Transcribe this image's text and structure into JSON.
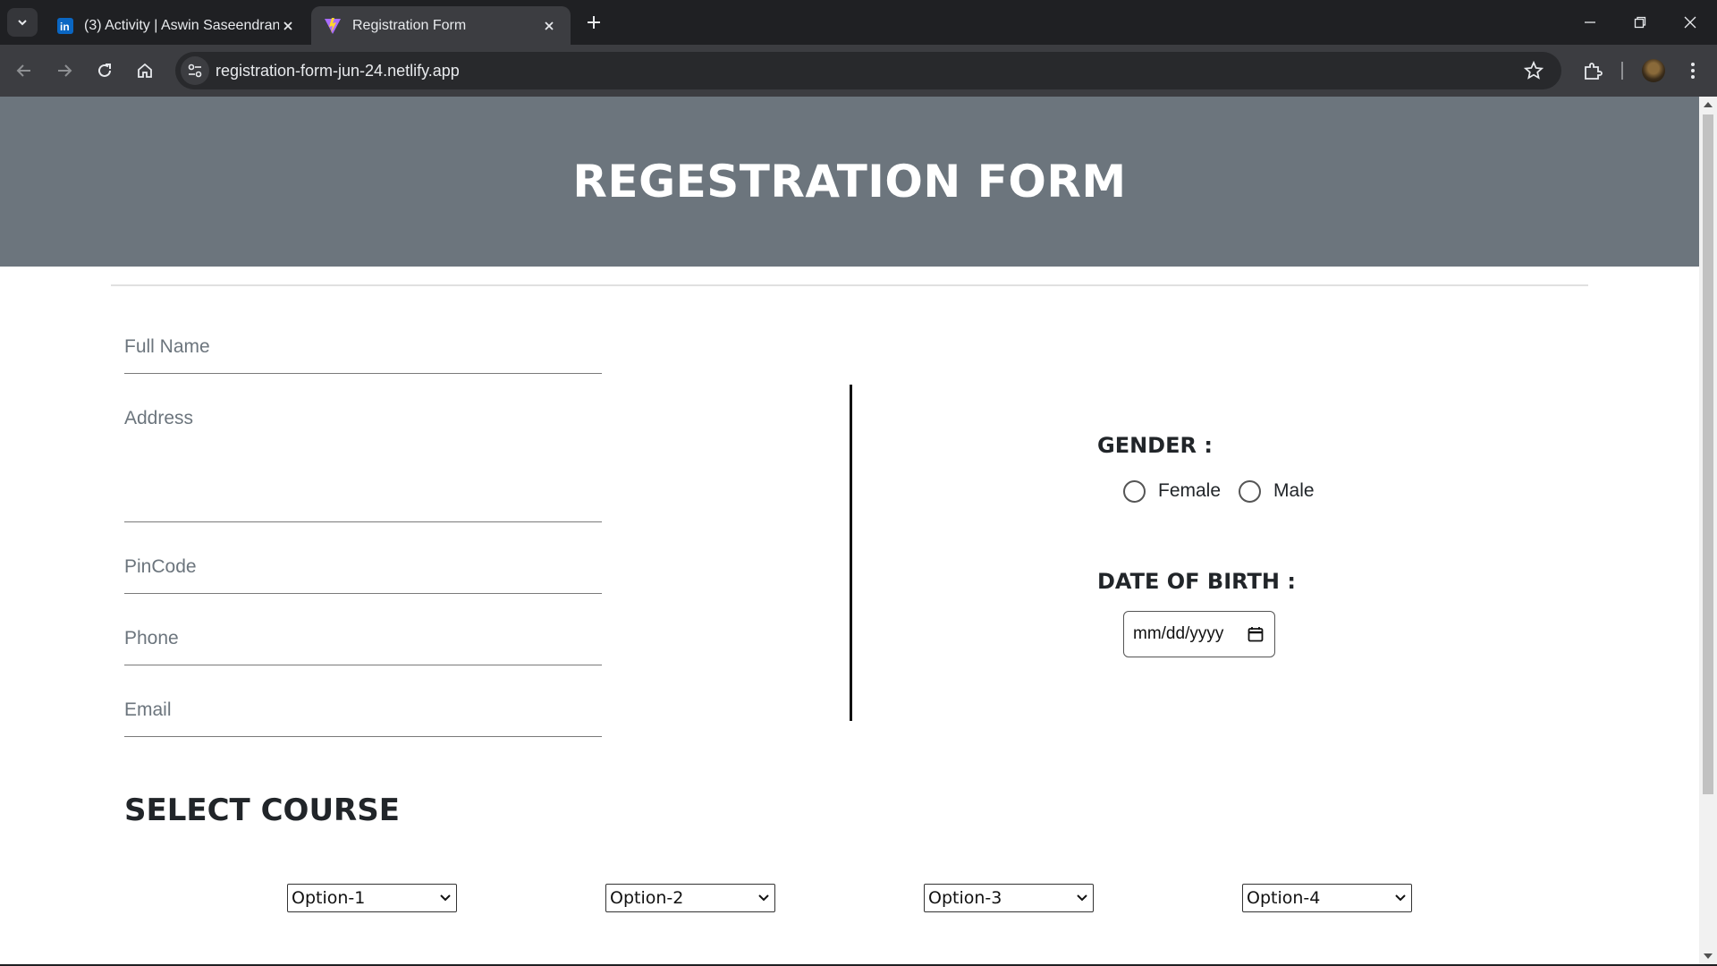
{
  "browser": {
    "tabs": [
      {
        "title": "(3) Activity | Aswin Saseendran |",
        "icon": "linkedin-icon",
        "active": false
      },
      {
        "title": "Registration Form",
        "icon": "vite-icon",
        "active": true
      }
    ],
    "url": "registration-form-jun-24.netlify.app"
  },
  "page": {
    "heading": "REGESTRATION FORM",
    "fields": {
      "full_name_placeholder": "Full Name",
      "address_placeholder": "Address",
      "pincode_placeholder": "PinCode",
      "phone_placeholder": "Phone",
      "email_placeholder": "Email"
    },
    "gender": {
      "label": "GENDER :",
      "options": [
        "Female",
        "Male"
      ]
    },
    "dob": {
      "label": "DATE OF BIRTH :",
      "placeholder": "mm/dd/yyyy"
    },
    "course": {
      "label": "SELECT COURSE",
      "selects": [
        "Option-1",
        "Option-2",
        "Option-3",
        "Option-4"
      ]
    }
  },
  "colors": {
    "hero_bg": "#6c757d",
    "chrome_dark": "#1f2023",
    "chrome_toolbar": "#3c3d41"
  }
}
